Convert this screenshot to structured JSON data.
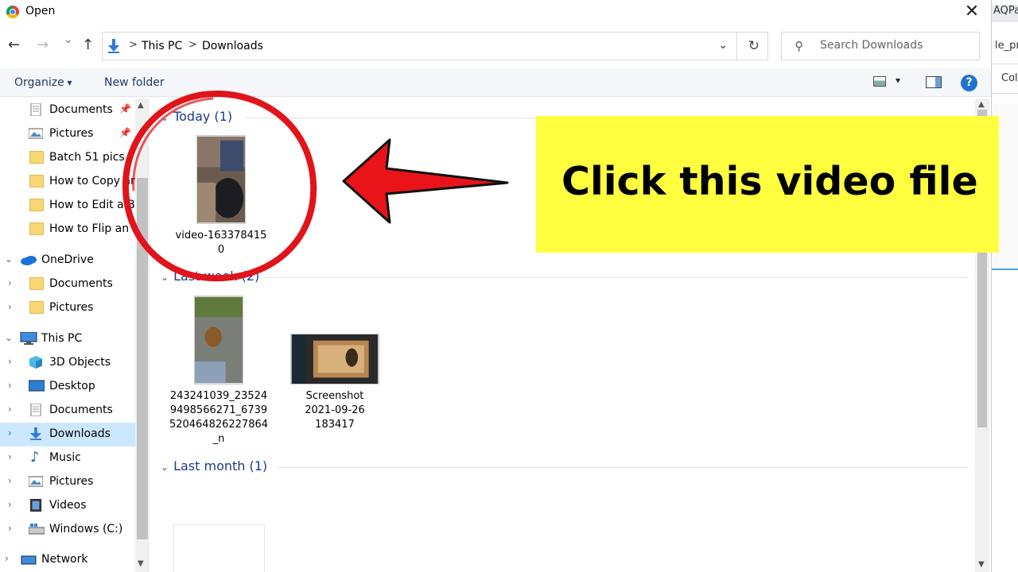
{
  "window": {
    "title": "Open",
    "close_glyph": "✕"
  },
  "navigation": {
    "back_glyph": "←",
    "forward_glyph": "→",
    "recent_glyph": "⌄",
    "up_glyph": "↑",
    "breadcrumb": [
      "This PC",
      "Downloads"
    ],
    "separator": ">",
    "refresh_glyph": "↻",
    "dropdown_glyph": "⌄"
  },
  "search": {
    "placeholder": "Search Downloads",
    "value": ""
  },
  "toolbar": {
    "organize_label": "Organize",
    "new_folder_label": "New folder",
    "help_label": "?"
  },
  "sidebar": {
    "quick_access": [
      {
        "label": "Documents",
        "icon": "documents-icon",
        "pinned": true
      },
      {
        "label": "Pictures",
        "icon": "pictures-icon",
        "pinned": true
      },
      {
        "label": "Batch 51 pics",
        "icon": "folder-icon"
      },
      {
        "label": "How to Copy an",
        "icon": "folder-icon"
      },
      {
        "label": "How to Edit a Bl",
        "icon": "folder-icon"
      },
      {
        "label": "How to Flip an I",
        "icon": "folder-icon"
      }
    ],
    "onedrive": {
      "label": "OneDrive",
      "children": [
        {
          "label": "Documents",
          "icon": "folder-icon"
        },
        {
          "label": "Pictures",
          "icon": "folder-icon"
        }
      ]
    },
    "this_pc": {
      "label": "This PC",
      "children": [
        {
          "label": "3D Objects",
          "icon": "3d-objects-icon"
        },
        {
          "label": "Desktop",
          "icon": "desktop-icon"
        },
        {
          "label": "Documents",
          "icon": "documents-icon"
        },
        {
          "label": "Downloads",
          "icon": "downloads-icon",
          "selected": true
        },
        {
          "label": "Music",
          "icon": "music-icon"
        },
        {
          "label": "Pictures",
          "icon": "pictures-icon"
        },
        {
          "label": "Videos",
          "icon": "videos-icon"
        },
        {
          "label": "Windows (C:)",
          "icon": "drive-icon"
        }
      ]
    },
    "network": {
      "label": "Network"
    }
  },
  "groups": [
    {
      "label": "Today (1)",
      "files": [
        {
          "name_line1": "video-163378415",
          "name_line2": "0"
        }
      ]
    },
    {
      "label": "Last week (2)",
      "files": [
        {
          "name_line1": "243241039_23524",
          "name_line2": "9498566271_6739",
          "name_line3": "520464826227864",
          "name_line4": "_n"
        },
        {
          "name_line1": "Screenshot",
          "name_line2": "2021-09-26",
          "name_line3": "183417"
        }
      ]
    },
    {
      "label": "Last month (1)",
      "files": []
    }
  ],
  "annotation": {
    "callout_text": "Click this video file",
    "callout_bg": "#ffff3f",
    "marker_color": "#e0141a"
  },
  "background_window": {
    "tab_text": "AQPa",
    "line2": "le_pr",
    "line3": "Col"
  },
  "colors": {
    "selected_bg": "#cce8ff",
    "group_header": "#1e3a8a",
    "help_blue": "#1f73d1"
  }
}
